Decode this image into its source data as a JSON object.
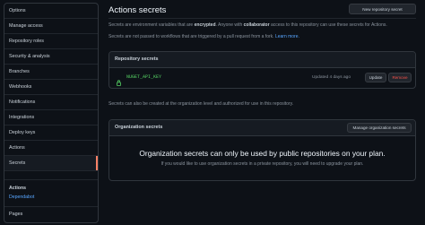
{
  "sidebar": {
    "items": [
      {
        "label": "Options"
      },
      {
        "label": "Manage access"
      },
      {
        "label": "Repository roles"
      },
      {
        "label": "Security & analysis"
      },
      {
        "label": "Branches"
      },
      {
        "label": "Webhooks"
      },
      {
        "label": "Notifications"
      },
      {
        "label": "Integrations"
      },
      {
        "label": "Deploy keys"
      },
      {
        "label": "Actions"
      },
      {
        "label": "Secrets"
      }
    ],
    "active": "Secrets",
    "section_heading": "Actions",
    "section_link": "Dependabot",
    "pages_label": "Pages",
    "accent_color": "#f78166"
  },
  "header": {
    "title": "Actions secrets",
    "new_secret_button": "New repository secret"
  },
  "intro": {
    "line1_a": "Secrets are environment variables that are ",
    "line1_b": "encrypted",
    "line1_c": ". Anyone with ",
    "line1_d": "collaborator",
    "line1_e": " access to this repository can use these secrets for Actions.",
    "line2_a": "Secrets are not passed to workflows that are triggered by a pull request from a fork. ",
    "line2_link": "Learn more."
  },
  "repo_secrets": {
    "heading": "Repository secrets",
    "rows": [
      {
        "name": "NUGET_API_KEY",
        "updated": "Updated 4 days ago",
        "update_label": "Update",
        "remove_label": "Remove"
      }
    ]
  },
  "org_note": "Secrets can also be created at the organization level and authorized for use in this repository.",
  "org_secrets": {
    "heading": "Organization secrets",
    "manage_button": "Manage organization secrets",
    "empty_title": "Organization secrets can only be used by public repositories on your plan.",
    "empty_sub": "If you would like to use organization secrets in a private repository, you will need to upgrade your plan."
  },
  "colors": {
    "background": "#0d1117",
    "border": "#30363d",
    "link": "#58a6ff",
    "secret_name": "#56d364",
    "danger": "#f85149"
  }
}
